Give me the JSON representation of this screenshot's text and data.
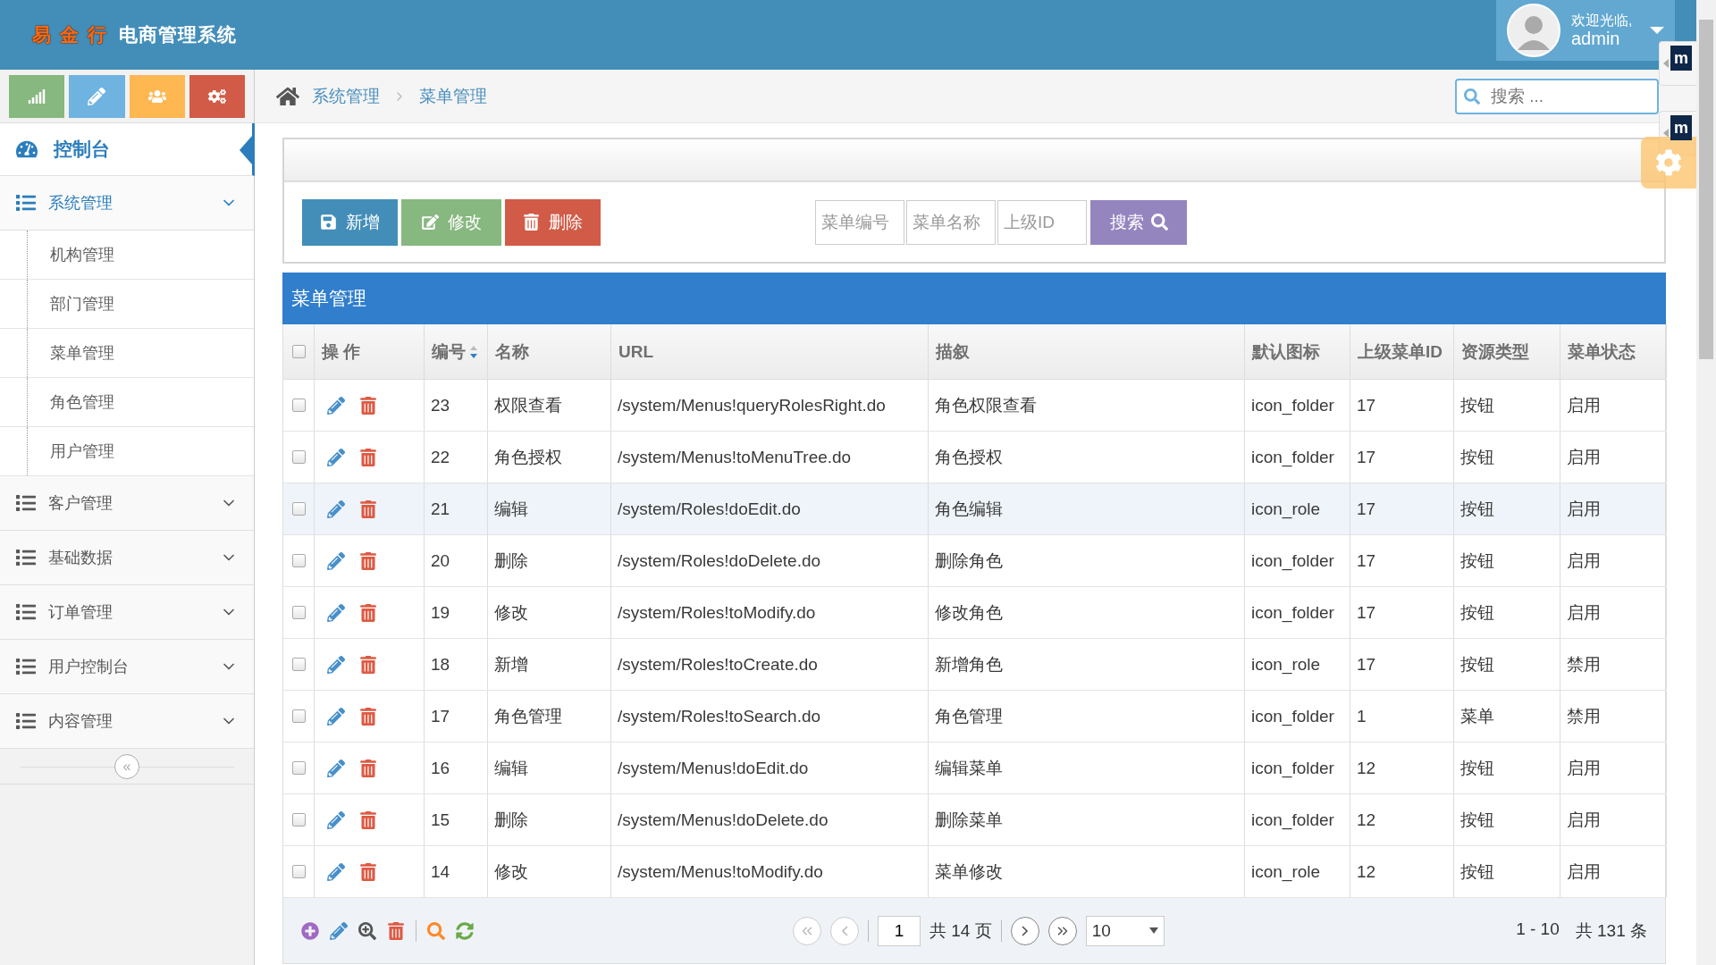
{
  "header": {
    "brand": "易 金 行",
    "title": "电商管理系统",
    "welcome": "欢迎光临,",
    "user": "admin"
  },
  "quick_buttons": [
    {
      "kind": "chart"
    },
    {
      "kind": "pencil"
    },
    {
      "kind": "users"
    },
    {
      "kind": "gears"
    }
  ],
  "sidebar": {
    "dashboard": "控制台",
    "collapse_icon": "«",
    "groups": [
      {
        "label": "系统管理",
        "expanded": true,
        "children": [
          {
            "label": "机构管理"
          },
          {
            "label": "部门管理"
          },
          {
            "label": "菜单管理"
          },
          {
            "label": "角色管理"
          },
          {
            "label": "用户管理"
          }
        ]
      },
      {
        "label": "客户管理",
        "expanded": false
      },
      {
        "label": "基础数据",
        "expanded": false
      },
      {
        "label": "订单管理",
        "expanded": false
      },
      {
        "label": "用户控制台",
        "expanded": false
      },
      {
        "label": "内容管理",
        "expanded": false
      }
    ]
  },
  "breadcrumb": [
    "系统管理",
    "菜单管理"
  ],
  "search": {
    "placeholder": "搜索 ..."
  },
  "side_tabs": [
    {
      "label": "m"
    },
    {
      "label": "m"
    }
  ],
  "toolbar": {
    "buttons": [
      {
        "label": "新增",
        "kind": "add"
      },
      {
        "label": "修改",
        "kind": "edit"
      },
      {
        "label": "删除",
        "kind": "delete"
      }
    ],
    "filters": [
      {
        "placeholder": "菜单编号"
      },
      {
        "placeholder": "菜单名称"
      },
      {
        "placeholder": "上级ID"
      }
    ],
    "search_button": "搜索"
  },
  "table": {
    "title": "菜单管理",
    "all_checked": false,
    "actions_label": "操 作",
    "columns": [
      {
        "label": "编号",
        "sorted": true
      },
      {
        "label": "名称"
      },
      {
        "label": "URL"
      },
      {
        "label": "描叙"
      },
      {
        "label": "默认图标"
      },
      {
        "label": "上级菜单ID"
      },
      {
        "label": "资源类型"
      },
      {
        "label": "菜单状态"
      }
    ],
    "rows": [
      {
        "checked": false,
        "hovered": false,
        "cells": [
          "23",
          "权限查看",
          "/system/Menus!queryRolesRight.do",
          "角色权限查看",
          "icon_folder",
          "17",
          "按钮",
          "启用"
        ]
      },
      {
        "checked": false,
        "hovered": false,
        "cells": [
          "22",
          "角色授权",
          "/system/Menus!toMenuTree.do",
          "角色授权",
          "icon_folder",
          "17",
          "按钮",
          "启用"
        ]
      },
      {
        "checked": false,
        "hovered": true,
        "cells": [
          "21",
          "编辑",
          "/system/Roles!doEdit.do",
          "角色编辑",
          "icon_role",
          "17",
          "按钮",
          "启用"
        ]
      },
      {
        "checked": false,
        "hovered": false,
        "cells": [
          "20",
          "删除",
          "/system/Roles!doDelete.do",
          "删除角色",
          "icon_folder",
          "17",
          "按钮",
          "启用"
        ]
      },
      {
        "checked": false,
        "hovered": false,
        "cells": [
          "19",
          "修改",
          "/system/Roles!toModify.do",
          "修改角色",
          "icon_folder",
          "17",
          "按钮",
          "启用"
        ]
      },
      {
        "checked": false,
        "hovered": false,
        "cells": [
          "18",
          "新增",
          "/system/Roles!toCreate.do",
          "新增角色",
          "icon_role",
          "17",
          "按钮",
          "禁用"
        ]
      },
      {
        "checked": false,
        "hovered": false,
        "cells": [
          "17",
          "角色管理",
          "/system/Roles!toSearch.do",
          "角色管理",
          "icon_folder",
          "1",
          "菜单",
          "禁用"
        ]
      },
      {
        "checked": false,
        "hovered": false,
        "cells": [
          "16",
          "编辑",
          "/system/Menus!doEdit.do",
          "编辑菜单",
          "icon_folder",
          "12",
          "按钮",
          "启用"
        ]
      },
      {
        "checked": false,
        "hovered": false,
        "cells": [
          "15",
          "删除",
          "/system/Menus!doDelete.do",
          "删除菜单",
          "icon_folder",
          "12",
          "按钮",
          "启用"
        ]
      },
      {
        "checked": false,
        "hovered": false,
        "cells": [
          "14",
          "修改",
          "/system/Menus!toModify.do",
          "菜单修改",
          "icon_role",
          "12",
          "按钮",
          "启用"
        ]
      }
    ]
  },
  "pager": {
    "page": "1",
    "pages": "共 14 页",
    "page_size": "10",
    "range": "1 - 10",
    "total": "共 131 条"
  }
}
